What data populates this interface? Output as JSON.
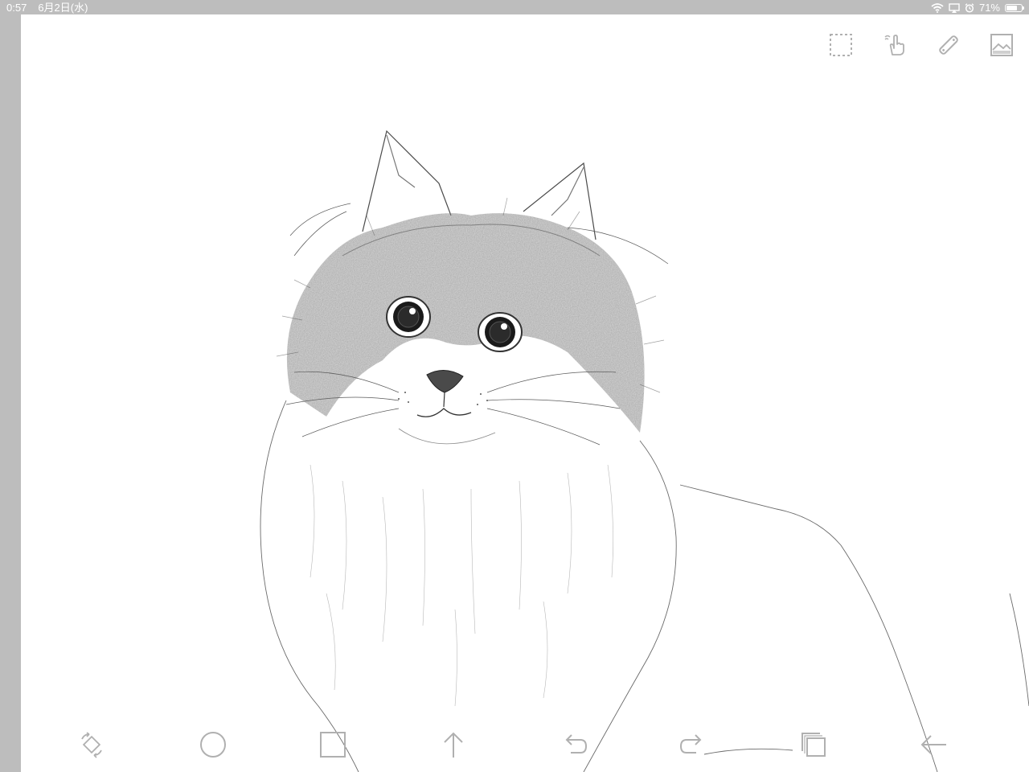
{
  "status_bar": {
    "time": "0:57",
    "date": "6月2日(水)",
    "battery_text": "71%",
    "battery_level": 0.71
  },
  "top_toolbar": [
    {
      "name": "selection-icon"
    },
    {
      "name": "touch-gesture-icon"
    },
    {
      "name": "ruler-icon"
    },
    {
      "name": "image-icon"
    }
  ],
  "bottom_toolbar": [
    {
      "name": "transform-icon"
    },
    {
      "name": "circle-shape-icon"
    },
    {
      "name": "square-shape-icon"
    },
    {
      "name": "arrow-up-icon"
    },
    {
      "name": "undo-icon"
    },
    {
      "name": "redo-icon"
    },
    {
      "name": "layers-icon"
    },
    {
      "name": "back-arrow-icon"
    }
  ],
  "colors": {
    "frame": "#bdbdbd",
    "canvas": "#ffffff",
    "icon": "#b0b0b0",
    "sketch": "#3a3a3a"
  }
}
